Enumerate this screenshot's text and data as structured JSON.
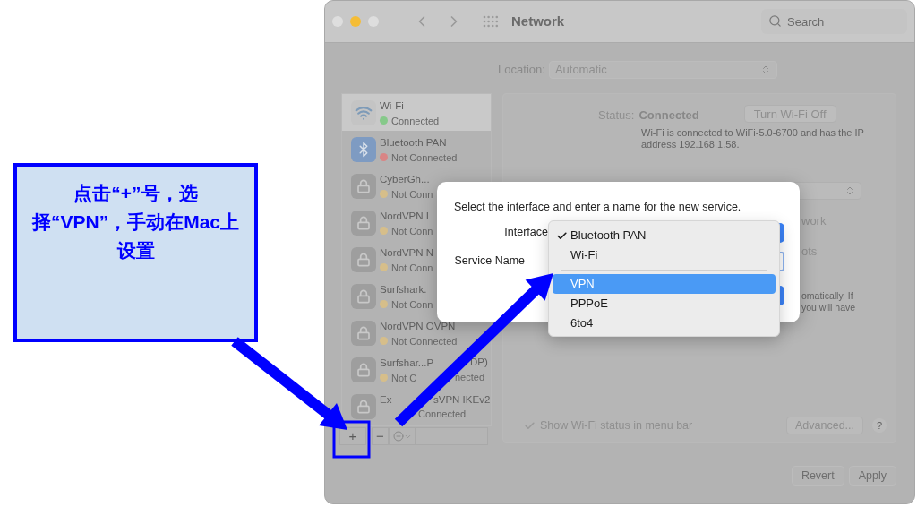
{
  "window": {
    "title": "Network",
    "search": {
      "placeholder": "Search"
    }
  },
  "location": {
    "label": "Location:",
    "value": "Automatic"
  },
  "services": [
    {
      "kind": "wifi",
      "name": "Wi-Fi",
      "status": "Connected",
      "color": "#86c98a",
      "selected": true
    },
    {
      "kind": "bluetooth",
      "name": "Bluetooth PAN",
      "status": "Not Connected",
      "color": "#d98585",
      "selected": false
    },
    {
      "kind": "vpn",
      "name": "CyberGh...",
      "status": "Not Conn",
      "color": "#d6be8a",
      "selected": false
    },
    {
      "kind": "vpn",
      "name": "NordVPN I",
      "status": "Not Conn",
      "color": "#d6be8a",
      "selected": false
    },
    {
      "kind": "vpn",
      "name": "NordVPN N",
      "status": "Not Conn",
      "color": "#d6be8a",
      "selected": false
    },
    {
      "kind": "vpn",
      "name": "Surfshark.",
      "status": "Not Conn",
      "color": "#d6be8a",
      "selected": false
    },
    {
      "kind": "vpn",
      "name": "NordVPN OVPN",
      "status": "Not Connected",
      "color": "#d6be8a",
      "selected": false
    },
    {
      "kind": "vpn",
      "name": "Surfshar...P",
      "name_tail": "DP)",
      "status": "Not C",
      "status_tail": "nected",
      "color": "#d6be8a",
      "selected": false
    },
    {
      "kind": "vpn",
      "name": "Ex",
      "name_tail": "sVPN IKEv2",
      "status_tail": "Connected",
      "selected": false
    }
  ],
  "list_controls": {
    "add": "+",
    "remove": "−"
  },
  "detail": {
    "status_label": "Status:",
    "status_value": "Connected",
    "toggle_button": "Turn Wi-Fi Off",
    "description": "Wi-Fi is connected to WiFi-5.0-6700 and has the IP address 192.168.1.58.",
    "row_1_end": "work",
    "row_2_end": "ots",
    "note_end": [
      "omatically. If",
      "you will have"
    ],
    "menu_bar_option": {
      "label": "Show Wi-Fi status in menu bar",
      "checked": true
    },
    "advanced_button": "Advanced...",
    "help_button": "?"
  },
  "footer_buttons": [
    "Revert",
    "Apply"
  ],
  "dialog": {
    "message": "Select the interface and enter a name for the new service.",
    "labels": [
      "Interface",
      "Service Name"
    ]
  },
  "menu": {
    "groups": [
      [
        {
          "label": "Bluetooth PAN",
          "checked": true,
          "selected": false
        },
        {
          "label": "Wi-Fi",
          "checked": false,
          "selected": false
        }
      ],
      [
        {
          "label": "VPN",
          "checked": false,
          "selected": true
        },
        {
          "label": "PPPoE",
          "checked": false,
          "selected": false
        },
        {
          "label": "6to4",
          "checked": false,
          "selected": false
        }
      ]
    ]
  },
  "annotation": {
    "callout": "点击“+”号，选择“VPN”，手动在Mac上设置"
  }
}
